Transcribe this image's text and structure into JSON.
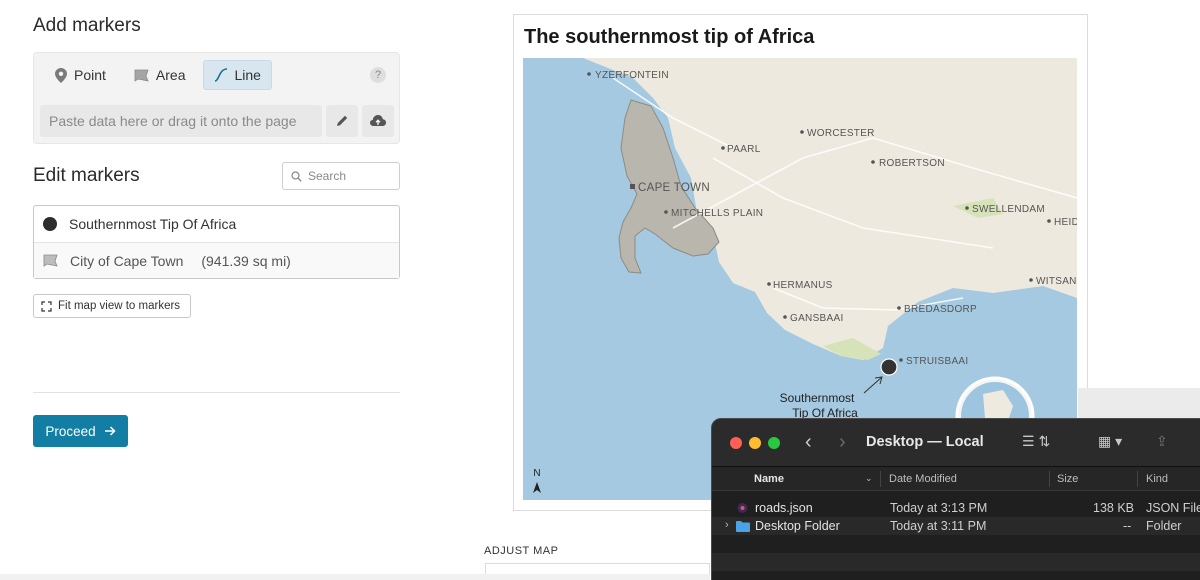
{
  "add_markers": {
    "heading": "Add markers",
    "tabs": [
      {
        "label": "Point",
        "icon": "pin-icon"
      },
      {
        "label": "Area",
        "icon": "area-flag-icon"
      },
      {
        "label": "Line",
        "icon": "line-curve-icon"
      }
    ],
    "active_tab": "Line",
    "help_label": "?",
    "paste_placeholder": "Paste data here or drag it onto the page"
  },
  "edit_markers": {
    "heading": "Edit markers",
    "search_placeholder": "Search",
    "markers": [
      {
        "name": "Southernmost Tip Of Africa",
        "type": "point"
      },
      {
        "name": "City of Cape Town",
        "size": "(941.39 sq mi)",
        "type": "area"
      }
    ],
    "fit_label": "Fit map view to markers"
  },
  "proceed_label": "Proceed",
  "map_card": {
    "title": "The southernmost tip of Africa",
    "places": [
      "YZERFONTEIN",
      "WORCESTER",
      "PAARL",
      "ROBERTSON",
      "CAPE TOWN",
      "MITCHELLS PLAIN",
      "SWELLENDAM",
      "HEID",
      "HERMANUS",
      "WITSAN",
      "BREDASDORP",
      "GANSBAAI",
      "STRUISBAAI"
    ],
    "marker_label_lines": [
      "Southernmost",
      "Tip Of Africa"
    ],
    "north_label": "N",
    "colors": {
      "sea": "#a4c9e0",
      "land": "#ede9de",
      "city_area": "#b9b6ad",
      "park": "#d6e3b9",
      "marker": "#333333"
    }
  },
  "adjust_map_label": "ADJUST MAP",
  "finder": {
    "title": "Desktop — Local",
    "columns": [
      "Name",
      "Date Modified",
      "Size",
      "Kind"
    ],
    "rows": [
      {
        "name": "roads.json",
        "date": "Today at 3:13 PM",
        "size": "138 KB",
        "kind": "JSON File",
        "icon": "json-file-icon"
      },
      {
        "name": "Desktop Folder",
        "date": "Today at 3:11 PM",
        "size": "--",
        "kind": "Folder",
        "icon": "folder-icon"
      }
    ],
    "colors": {
      "close": "#ff5f57",
      "minimize": "#febc2e",
      "zoom": "#28c840",
      "folder": "#4aa3e6"
    }
  }
}
